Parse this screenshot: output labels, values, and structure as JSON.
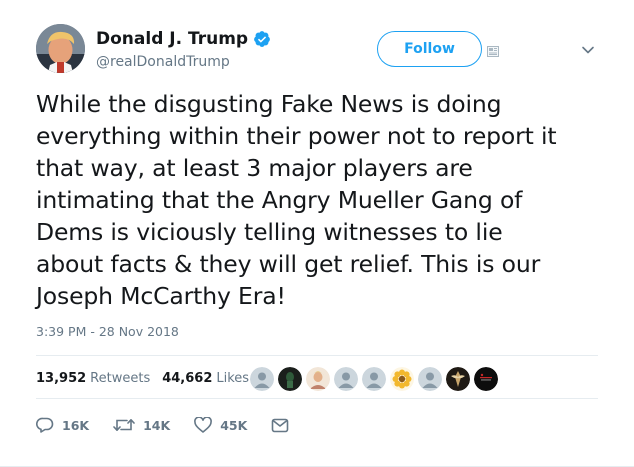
{
  "author": {
    "display_name": "Donald J. Trump",
    "handle": "@realDonaldTrump",
    "verified": true,
    "avatar": "profile-photo"
  },
  "follow_button": {
    "label": "Follow"
  },
  "icons": {
    "verified": "verified-badge-icon",
    "notifications": "notification-icon",
    "more": "chevron-down-icon",
    "reply": "reply-icon",
    "retweet": "retweet-icon",
    "like": "heart-icon",
    "dm": "envelope-icon"
  },
  "tweet": {
    "text": "While the disgusting Fake News is doing\neverything within their power not to report it\nthat way, at least 3 major players are\nintimating that the Angry Mueller Gang of\nDems is viciously telling witnesses to lie\nabout facts & they will get relief. This is our\nJoseph McCarthy Era!",
    "timestamp": "3:39 PM - 28 Nov 2018"
  },
  "stats": {
    "retweets_count": "13,952",
    "retweets_label": "Retweets",
    "likes_count": "44,662",
    "likes_label": "Likes"
  },
  "likers": [
    {
      "kind": "default-egg"
    },
    {
      "kind": "dark-photo"
    },
    {
      "kind": "photo-portrait"
    },
    {
      "kind": "default-egg"
    },
    {
      "kind": "default-egg"
    },
    {
      "kind": "flower-photo"
    },
    {
      "kind": "default-egg"
    },
    {
      "kind": "bird-photo"
    },
    {
      "kind": "dark-logo"
    }
  ],
  "actions": {
    "replies": "16K",
    "retweets": "14K",
    "likes": "45K"
  },
  "colors": {
    "accent": "#1da1f2",
    "text": "#14171a",
    "secondary": "#657786",
    "divider": "#e6ecf0"
  }
}
